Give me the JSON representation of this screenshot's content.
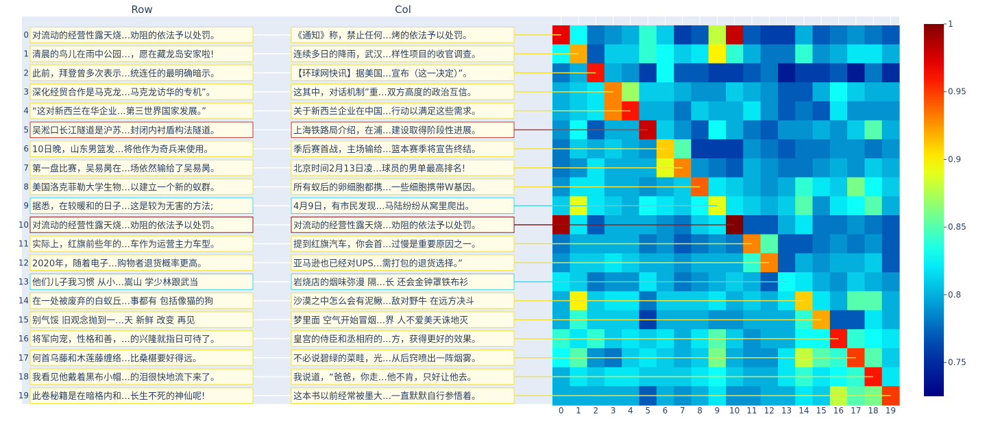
{
  "headers": {
    "row": "Row",
    "col": "Col"
  },
  "chart_data": {
    "type": "heatmap",
    "title": "",
    "xlabel": "",
    "ylabel": "",
    "x_ticks": [
      "0",
      "1",
      "2",
      "3",
      "4",
      "5",
      "6",
      "7",
      "8",
      "9",
      "10",
      "11",
      "12",
      "13",
      "14",
      "15",
      "16",
      "17",
      "18",
      "19"
    ],
    "colorscale": "jet",
    "zlim": [
      0.725,
      1
    ],
    "colorbar_ticks": [
      "1",
      "0.95",
      "0.9",
      "0.85",
      "0.8",
      "0.75"
    ],
    "row_labels": [
      "对流动的经营性露天烧…劝阻的依法予以处罚。",
      "清晨的鸟儿在雨中公园…，愿在藏龙岛安家啦!",
      "此前，拜登曾多次表示…统连任的最明确暗示。",
      "深化经贸合作是马克龙…马克龙访华的专机”。",
      "“这对新西兰在华企业…第三世界国家发展。”",
      "吴淞口长江隧道是沪苏…封闭内衬盾构法隧道。",
      "10日晚，山东男篮发…将他作为奇兵来使用。",
      "第一盘比赛，吴易昺在…场依然输给了吴易昺。",
      "美国洛克菲勒大学生物…以建立一个新的蚁群。",
      "据悉，在较暖和的日子…这是较为无害的方法;",
      "对流动的经营性露天烧…劝阻的依法予以处罚。",
      "实际上，红旗前些年的…车作为运营主力车型。",
      "2020年，随着电子…购物者退货概率更高。",
      "他们儿子我习惯 从小…嵩山 学少林跟武当",
      "在一处被废弃的白蚁丘…事都有 包括像猫的狗",
      "别气馁 旧观念抛到一…天 新鲜 改变 再见",
      "将军向宠，性格和善，…的兴隆就指日可待了。",
      "何首乌藤和木莲藤缠络…比桑椹要好得远。",
      "我看见他戴着黑布小帽…的泪很快地流下来了。",
      "此卷秘籍是在暗格内和…长生不死的神仙呢!"
    ],
    "col_labels": [
      "《通知》称，禁止任何…烤的依法予以处罚。",
      "连续多日的降雨，武汉…样性项目的收官调查。",
      "【环球网快讯】据美国…宣布（这一决定）”。",
      "这其中，对话机制”重…双方高度的政治互信。",
      "关于新西兰企业在中国…行动以满足这些需求。",
      "上海铁路局介绍，在浦…建设取得阶段性进展。",
      "季后赛首战，主场输给…篮本赛季将宣告终结。",
      "北京时间2月13日凌…球员的男单最高排名!",
      "所有蚁后的卵细胞都携…一些细胞携带W基因。",
      "4月9日，有市民发现…马陆纷纷从窝里爬出。",
      "对流动的经营性露天烧…劝阻的依法予以处罚。",
      "提到红旗汽车，你会首…过慢是重要原因之一。",
      "亚马逊也已经对UPS…需打包的退货选择。”",
      "岩烧店的烟味弥漫 隔…长 还会金钟罩铁布衫",
      "沙漠之中怎么会有泥鳅…敌对野牛 在远方决斗",
      "梦里面 空气开始冒烟…界 人不爱美天诛地灭",
      "皇宫的侍臣和丞相府的…方，获得更好的效果。",
      "不必说碧绿的菜畦，光…从后窍喷出一阵烟雾。",
      "我说道，“爸爸，你走…他不肯，只好让他去。",
      "这本书以前经常被墨大…一直默默自行参悟着。"
    ],
    "highlighted_pairs": [
      {
        "row": 5,
        "col": 5,
        "color": "#c0392b"
      },
      {
        "row": 9,
        "col": 9,
        "color": "#41d7e8"
      },
      {
        "row": 10,
        "col": 10,
        "color": "#8b1a1a"
      },
      {
        "row": 13,
        "col": 13,
        "color": "#41d7e8"
      }
    ],
    "default_pair_color": "#f4e13c",
    "z": [
      [
        0.97,
        0.83,
        0.78,
        0.79,
        0.8,
        0.84,
        0.81,
        0.76,
        0.77,
        0.88,
        0.98,
        0.77,
        0.76,
        0.76,
        0.8,
        0.77,
        0.78,
        0.79,
        0.78,
        0.77
      ],
      [
        0.83,
        0.92,
        0.77,
        0.81,
        0.81,
        0.84,
        0.83,
        0.81,
        0.82,
        0.9,
        0.84,
        0.8,
        0.78,
        0.78,
        0.84,
        0.79,
        0.8,
        0.82,
        0.82,
        0.8
      ],
      [
        0.78,
        0.8,
        0.96,
        0.8,
        0.79,
        0.76,
        0.83,
        0.77,
        0.77,
        0.76,
        0.76,
        0.77,
        0.78,
        0.74,
        0.76,
        0.76,
        0.77,
        0.74,
        0.78,
        0.75
      ],
      [
        0.8,
        0.81,
        0.82,
        0.93,
        0.87,
        0.81,
        0.81,
        0.8,
        0.79,
        0.79,
        0.81,
        0.8,
        0.79,
        0.77,
        0.77,
        0.8,
        0.83,
        0.81,
        0.8,
        0.8
      ],
      [
        0.8,
        0.81,
        0.82,
        0.93,
        0.96,
        0.8,
        0.8,
        0.78,
        0.81,
        0.8,
        0.8,
        0.82,
        0.79,
        0.77,
        0.78,
        0.77,
        0.82,
        0.79,
        0.79,
        0.79
      ],
      [
        0.79,
        0.83,
        0.77,
        0.8,
        0.8,
        0.98,
        0.81,
        0.79,
        0.77,
        0.83,
        0.8,
        0.78,
        0.77,
        0.79,
        0.79,
        0.8,
        0.79,
        0.81,
        0.85,
        0.8
      ],
      [
        0.78,
        0.81,
        0.8,
        0.81,
        0.8,
        0.79,
        0.91,
        0.85,
        0.76,
        0.76,
        0.76,
        0.79,
        0.78,
        0.77,
        0.78,
        0.78,
        0.79,
        0.79,
        0.78,
        0.79
      ],
      [
        0.78,
        0.79,
        0.82,
        0.8,
        0.8,
        0.8,
        0.89,
        0.93,
        0.79,
        0.78,
        0.77,
        0.8,
        0.79,
        0.78,
        0.78,
        0.79,
        0.8,
        0.79,
        0.81,
        0.8
      ],
      [
        0.79,
        0.82,
        0.82,
        0.8,
        0.8,
        0.79,
        0.8,
        0.81,
        0.94,
        0.82,
        0.81,
        0.8,
        0.79,
        0.8,
        0.84,
        0.82,
        0.81,
        0.86,
        0.83,
        0.81
      ],
      [
        0.81,
        0.89,
        0.82,
        0.81,
        0.8,
        0.83,
        0.82,
        0.81,
        0.83,
        0.89,
        0.82,
        0.81,
        0.8,
        0.81,
        0.85,
        0.79,
        0.82,
        0.83,
        0.85,
        0.8
      ],
      [
        0.99,
        0.82,
        0.77,
        0.8,
        0.8,
        0.8,
        0.79,
        0.78,
        0.81,
        0.82,
        1.0,
        0.77,
        0.77,
        0.8,
        0.82,
        0.78,
        0.78,
        0.79,
        0.78,
        0.77
      ],
      [
        0.78,
        0.8,
        0.8,
        0.8,
        0.8,
        0.78,
        0.79,
        0.77,
        0.78,
        0.79,
        0.78,
        0.93,
        0.85,
        0.77,
        0.77,
        0.78,
        0.79,
        0.78,
        0.79,
        0.77
      ],
      [
        0.79,
        0.81,
        0.81,
        0.82,
        0.81,
        0.8,
        0.8,
        0.79,
        0.8,
        0.8,
        0.8,
        0.84,
        0.93,
        0.77,
        0.8,
        0.79,
        0.8,
        0.8,
        0.81,
        0.77
      ],
      [
        0.82,
        0.81,
        0.78,
        0.79,
        0.79,
        0.82,
        0.8,
        0.78,
        0.79,
        0.8,
        0.81,
        0.8,
        0.77,
        0.83,
        0.82,
        0.8,
        0.79,
        0.81,
        0.8,
        0.79
      ],
      [
        0.8,
        0.9,
        0.81,
        0.82,
        0.82,
        0.78,
        0.81,
        0.81,
        0.81,
        0.82,
        0.8,
        0.81,
        0.8,
        0.82,
        0.91,
        0.82,
        0.8,
        0.85,
        0.85,
        0.8
      ],
      [
        0.8,
        0.84,
        0.81,
        0.81,
        0.81,
        0.76,
        0.8,
        0.8,
        0.8,
        0.79,
        0.79,
        0.8,
        0.8,
        0.8,
        0.84,
        0.92,
        0.77,
        0.77,
        0.82,
        0.8
      ],
      [
        0.84,
        0.82,
        0.84,
        0.81,
        0.82,
        0.81,
        0.82,
        0.8,
        0.82,
        0.85,
        0.81,
        0.79,
        0.8,
        0.8,
        0.83,
        0.83,
        0.96,
        0.84,
        0.83,
        0.82
      ],
      [
        0.83,
        0.85,
        0.79,
        0.78,
        0.81,
        0.82,
        0.81,
        0.8,
        0.81,
        0.86,
        0.8,
        0.79,
        0.79,
        0.82,
        0.88,
        0.85,
        0.84,
        0.95,
        0.85,
        0.81
      ],
      [
        0.8,
        0.82,
        0.81,
        0.82,
        0.82,
        0.81,
        0.81,
        0.81,
        0.82,
        0.83,
        0.81,
        0.8,
        0.8,
        0.82,
        0.84,
        0.82,
        0.83,
        0.84,
        0.96,
        0.82
      ],
      [
        0.8,
        0.8,
        0.8,
        0.8,
        0.8,
        0.77,
        0.8,
        0.79,
        0.8,
        0.82,
        0.79,
        0.79,
        0.8,
        0.8,
        0.82,
        0.81,
        0.88,
        0.85,
        0.86,
        0.95
      ]
    ]
  }
}
